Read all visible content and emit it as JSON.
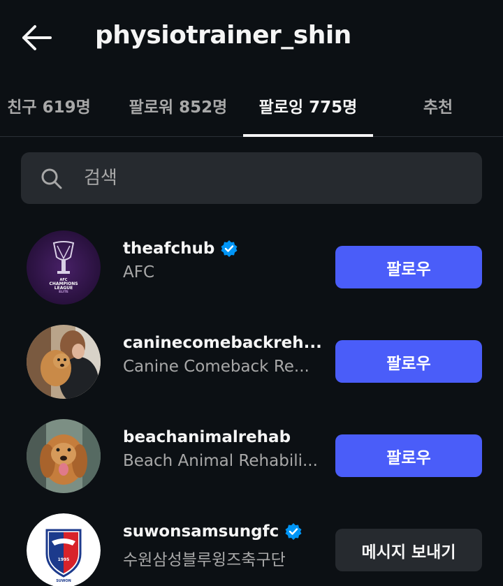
{
  "header": {
    "title": "physiotrainer_shin",
    "back_icon": "arrow-left-icon"
  },
  "tabs": [
    {
      "label": "친구 619명"
    },
    {
      "label": "팔로워 852명"
    },
    {
      "label": "팔로잉 775명",
      "active": true
    },
    {
      "label": "추천"
    }
  ],
  "search": {
    "placeholder": "검색",
    "icon": "search-icon"
  },
  "accounts": [
    {
      "username": "theafchub",
      "verified": true,
      "full_name": "AFC",
      "action_label": "팔로우",
      "avatar_text": [
        "AFC",
        "CHAMPIONS",
        "LEAGUE",
        "ELITE"
      ]
    },
    {
      "username": "caninecomebackreh...",
      "verified": false,
      "full_name": "Canine Comeback Re...",
      "action_label": "팔로우"
    },
    {
      "username": "beachanimalrehab",
      "verified": false,
      "full_name": "Beach Animal Rehabili...",
      "action_label": "팔로우"
    },
    {
      "username": "suwonsamsungfc",
      "verified": true,
      "full_name": "수원삼성블루윙즈축구단",
      "action_label": "메시지 보내기",
      "avatar_text": [
        "1995",
        "SUWON"
      ]
    }
  ],
  "colors": {
    "background": "#0c1014",
    "accent": "#4a5df9",
    "verified": "#0095f6",
    "secondary_text": "#a8a8a8",
    "surface": "#262a2f"
  }
}
